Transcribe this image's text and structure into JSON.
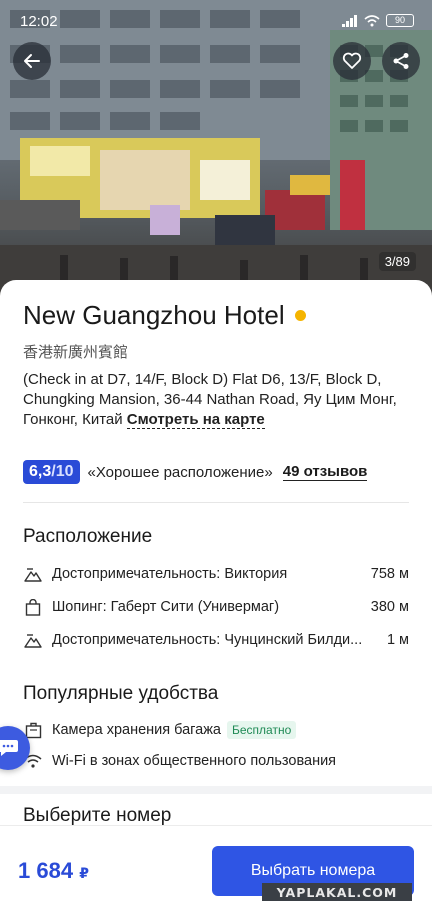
{
  "status_bar": {
    "time": "12:02",
    "battery": "90"
  },
  "photo": {
    "counter": "3/89"
  },
  "hotel": {
    "name": "New Guangzhou Hotel",
    "local_name": "香港新廣州賓館",
    "address": "(Check in at D7, 14/F, Block D) Flat D6, 13/F, Block D, Chungking Mansion, 36-44 Nathan Road, Яу Цим Монг, Гонконг, Китай",
    "map_link": "Смотреть на карте"
  },
  "rating": {
    "score": "6,3",
    "out_of": "/10",
    "label": "«Хорошее расположение»",
    "reviews": "49 отзывов"
  },
  "location": {
    "title": "Расположение",
    "items": [
      {
        "icon": "landmark-icon",
        "name": "Достопримечательность: Виктория",
        "distance": "758 м"
      },
      {
        "icon": "shopping-bag-icon",
        "name": "Шопинг: Габерт Сити (Универмаг)",
        "distance": "380 м"
      },
      {
        "icon": "landmark-icon",
        "name": "Достопримечательность: Чунцинский Билди...",
        "distance": "1 м"
      }
    ]
  },
  "amenities": {
    "title": "Популярные удобства",
    "items": [
      {
        "icon": "luggage-icon",
        "name": "Камера хранения багажа",
        "badge": "Бесплатно"
      },
      {
        "icon": "wifi-icon",
        "name": "Wi-Fi в зонах общественного пользования"
      }
    ]
  },
  "rooms": {
    "title": "Выберите номер"
  },
  "footer": {
    "price": "1 684",
    "currency": "₽",
    "cta": "Выбрать номера",
    "watermark": "YAPLAKAL.COM"
  },
  "colors": {
    "accent": "#2a4bd7",
    "rating_dot": "#f5b400",
    "badge_green": "#1f8a55"
  }
}
